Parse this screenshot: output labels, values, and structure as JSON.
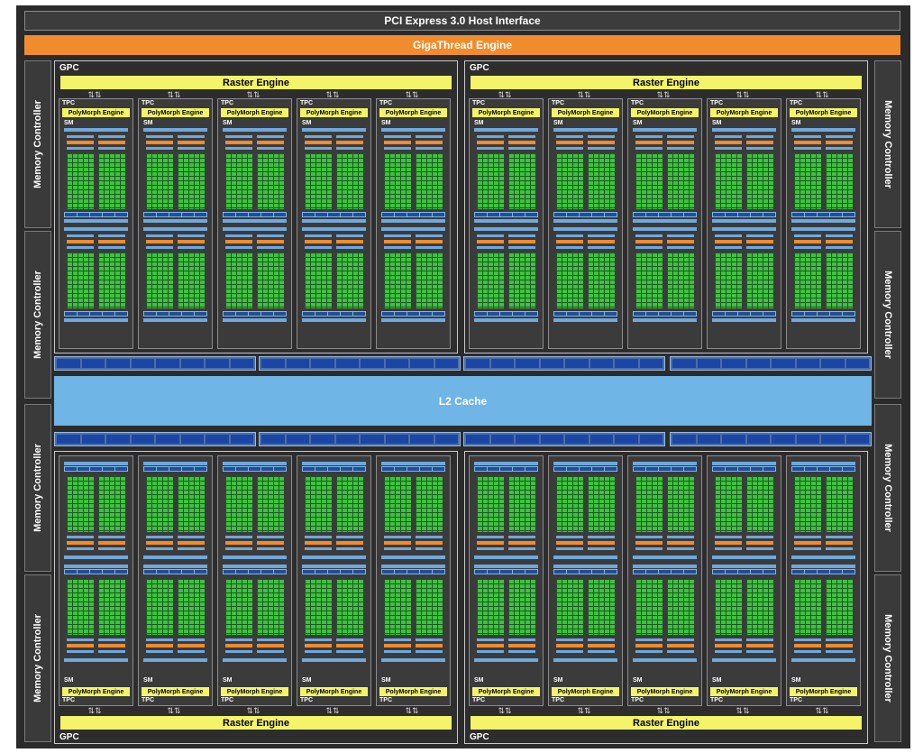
{
  "pcie": "PCI Express 3.0 Host Interface",
  "gigathread": "GigaThread Engine",
  "l2_cache": "L2 Cache",
  "memory_controller": "Memory Controller",
  "gpc_label": "GPC",
  "raster_engine": "Raster Engine",
  "tpc_label": "TPC",
  "polymorph_engine": "PolyMorph Engine",
  "sm_label": "SM",
  "colors": {
    "background": "#2b2b2b",
    "gigathread": "#f08c2e",
    "raster": "#f4f46a",
    "cuda_cores": "#3ec23e",
    "l2_cache": "#6fb5e6",
    "l1_blocks": "#1b46a5"
  }
}
